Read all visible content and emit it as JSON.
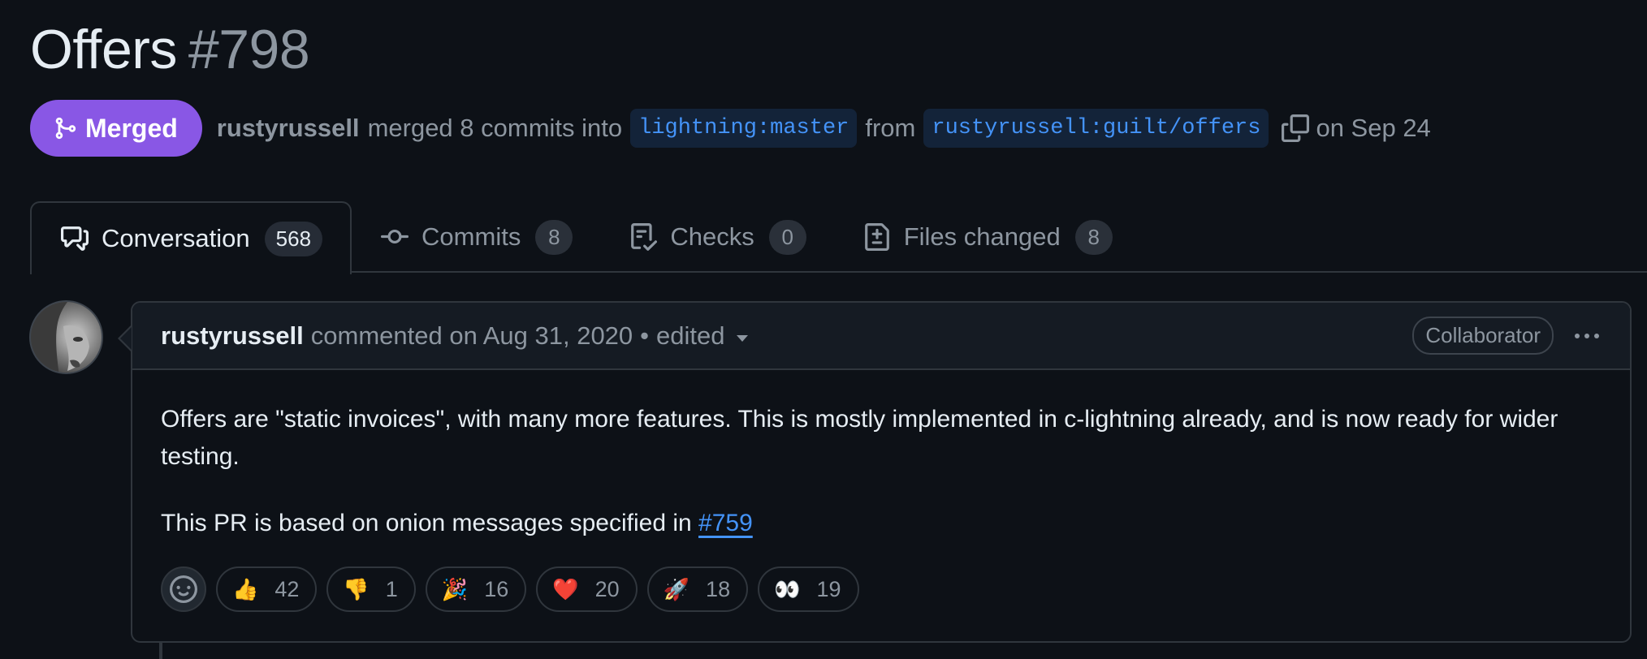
{
  "pr": {
    "title": "Offers",
    "number": "#798",
    "state": "Merged",
    "author": "rustyrussell",
    "merge_text": "merged 8 commits into",
    "base_branch": "lightning:master",
    "from_text": "from",
    "head_branch": "rustyrussell:guilt/offers",
    "date_text": "on Sep 24"
  },
  "tabs": [
    {
      "label": "Conversation",
      "count": "568",
      "icon": "comment-discussion-icon"
    },
    {
      "label": "Commits",
      "count": "8",
      "icon": "git-commit-icon"
    },
    {
      "label": "Checks",
      "count": "0",
      "icon": "checklist-icon"
    },
    {
      "label": "Files changed",
      "count": "8",
      "icon": "file-diff-icon"
    }
  ],
  "comment": {
    "author": "rustyrussell",
    "commented_text": "commented on Aug 31, 2020",
    "dot": "•",
    "edited": "edited",
    "role": "Collaborator",
    "paragraph1": "Offers are \"static invoices\", with many more features. This is mostly implemented in c-lightning already, and is now ready for wider testing.",
    "paragraph2_prefix": "This PR is based on onion messages specified in",
    "paragraph2_link": "#759"
  },
  "reactions": [
    {
      "emoji": "👍",
      "count": "42"
    },
    {
      "emoji": "👎",
      "count": "1"
    },
    {
      "emoji": "🎉",
      "count": "16"
    },
    {
      "emoji": "❤️",
      "count": "20"
    },
    {
      "emoji": "🚀",
      "count": "18"
    },
    {
      "emoji": "👀",
      "count": "19"
    }
  ],
  "colors": {
    "background": "#0d1117",
    "merged_purple": "#8957e5",
    "link_blue": "#4493f8",
    "border": "#30363d",
    "muted_text": "#8d96a0"
  }
}
